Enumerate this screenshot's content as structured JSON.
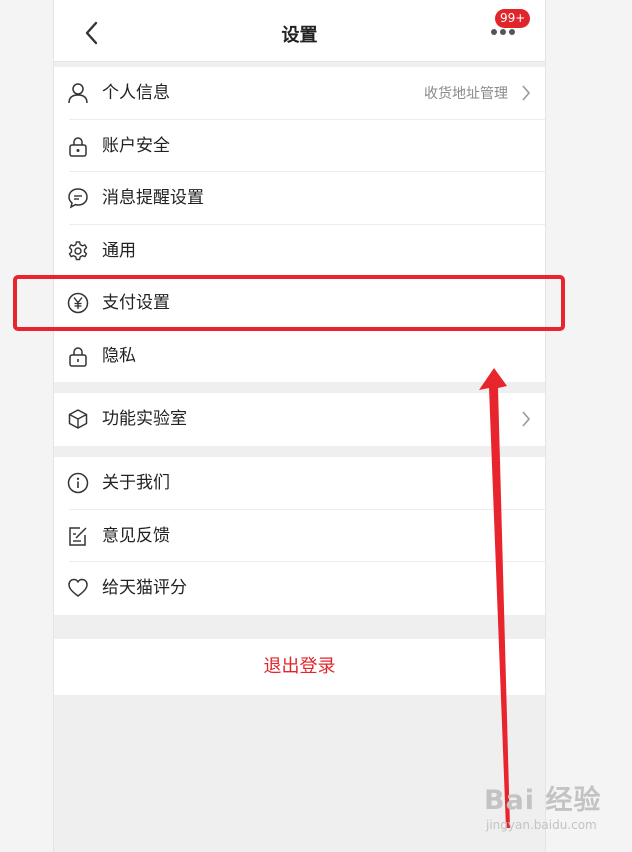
{
  "nav": {
    "title": "设置",
    "back_icon": "chevron-left-icon",
    "more_icon": "more-dots-icon",
    "badge": "99+"
  },
  "groups": [
    {
      "items": [
        {
          "label": "个人信息",
          "icon": "user-icon",
          "extra": "收货地址管理",
          "chevron": true
        },
        {
          "label": "账户安全",
          "icon": "lock-icon"
        },
        {
          "label": "消息提醒设置",
          "icon": "message-icon"
        },
        {
          "label": "通用",
          "icon": "gear-icon"
        },
        {
          "label": "支付设置",
          "icon": "yen-icon"
        },
        {
          "label": "隐私",
          "icon": "privacy-lock-icon"
        }
      ]
    },
    {
      "items": [
        {
          "label": "功能实验室",
          "icon": "cube-icon",
          "chevron": true
        }
      ]
    },
    {
      "items": [
        {
          "label": "关于我们",
          "icon": "info-icon"
        },
        {
          "label": "意见反馈",
          "icon": "feedback-icon"
        },
        {
          "label": "给天猫评分",
          "icon": "heart-icon"
        }
      ]
    }
  ],
  "logout_label": "退出登录",
  "annotation": {
    "color": "#e8242c"
  },
  "watermark": {
    "main": "Bai 经验",
    "sub": "jingyan.baidu.com"
  },
  "colors": {
    "accent": "#e0262a",
    "background": "#efefef",
    "text": "#222222",
    "secondary": "#8a8a8a"
  }
}
